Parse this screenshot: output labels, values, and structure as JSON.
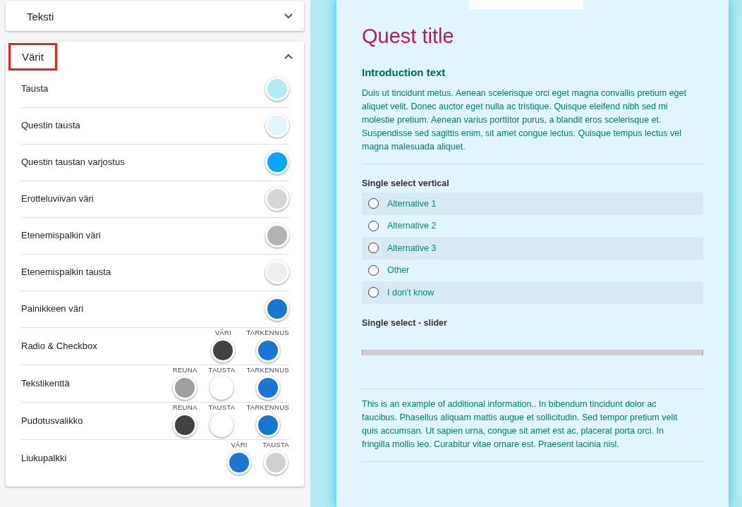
{
  "settings_panel": {
    "sections": [
      {
        "title": "Teksti",
        "expanded": false,
        "highlighted": false
      },
      {
        "title": "Värit",
        "expanded": true,
        "highlighted": true,
        "rows": [
          {
            "label": "Tausta",
            "swatches": [
              {
                "color": "#b2ebf2"
              }
            ]
          },
          {
            "label": "Questin tausta",
            "swatches": [
              {
                "color": "#e1f5fe"
              }
            ]
          },
          {
            "label": "Questin taustan varjostus",
            "swatches": [
              {
                "color": "#03a9f4"
              }
            ]
          },
          {
            "label": "Erotteluviivan väri",
            "swatches": [
              {
                "color": "#d6d6d6"
              }
            ]
          },
          {
            "label": "Etenemispalkin väri",
            "swatches": [
              {
                "color": "#b3b3b3"
              }
            ]
          },
          {
            "label": "Etenemispalkin tausta",
            "swatches": [
              {
                "color": "#eeeeee"
              }
            ]
          },
          {
            "label": "Painikkeen väri",
            "swatches": [
              {
                "color": "#1976d2"
              }
            ]
          },
          {
            "label": "Radio & Checkbox",
            "swatches": [
              {
                "caption": "VÄRI",
                "color": "#424242"
              },
              {
                "caption": "TARKENNUS",
                "color": "#1976d2"
              }
            ]
          },
          {
            "label": "Tekstikenttä",
            "swatches": [
              {
                "caption": "REUNA",
                "color": "#a0a0a0"
              },
              {
                "caption": "TAUSTA",
                "color": "#ffffff"
              },
              {
                "caption": "TARKENNUS",
                "color": "#1976d2"
              }
            ]
          },
          {
            "label": "Pudotusvalikko",
            "swatches": [
              {
                "caption": "REUNA",
                "color": "#424242"
              },
              {
                "caption": "TAUSTA",
                "color": "#ffffff"
              },
              {
                "caption": "TARKENNUS",
                "color": "#1976d2"
              }
            ]
          },
          {
            "label": "Liukupalkki",
            "swatches": [
              {
                "caption": "VÄRI",
                "color": "#1976d2"
              },
              {
                "caption": "TAUSTA",
                "color": "#cfcfd4"
              }
            ]
          }
        ]
      }
    ]
  },
  "preview": {
    "title": "Quest title",
    "intro_heading": "Introduction text",
    "intro_text": "Duis ut tincidunt metus. Aenean scelerisque orci eget magna convallis pretium eget aliquet velit. Donec auctor eget nulla ac tristique. Quisque eleifend nibh sed mi molestie pretium. Aenean varius porttitor purus, a blandit eros scelerisque et. Suspendisse sed sagittis enim, sit amet congue lectus. Quisque tempus lectus vel magna malesuada aliquet.",
    "questions": [
      {
        "kind": "radio",
        "title": "Single select vertical",
        "options": [
          {
            "label": "Alternative 1",
            "selected": false
          },
          {
            "label": "Alternative 2",
            "selected": false
          },
          {
            "label": "Alternative 3",
            "selected": false
          },
          {
            "label": "Other",
            "selected": false
          },
          {
            "label": "I don't know",
            "selected": false
          }
        ]
      },
      {
        "kind": "slider",
        "title": "Single select - slider"
      }
    ],
    "additional_info": "This is an example of additional information.. In bibendum tincidunt dolor ac faucibus. Phasellus aliquam mattis augue et sollicitudin. Sed tempor pretium velit quis accumsan. Ut sapien urna, congue sit amet est ac, placerat porta orci. In fringilla mollis leo. Curabitur vitae ornare est. Praesent lacinia nisl."
  }
}
